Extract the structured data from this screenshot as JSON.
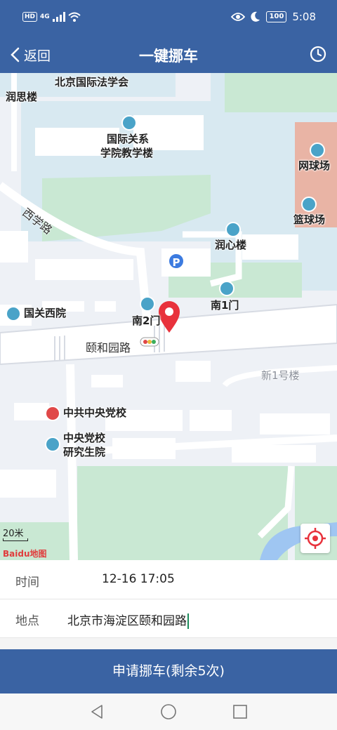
{
  "status_bar": {
    "hd": "HD",
    "network": "4G",
    "battery": "100",
    "time": "5:08"
  },
  "nav": {
    "back_label": "返回",
    "title": "一键挪车"
  },
  "map": {
    "pois": {
      "law_society": "北京国际法学会",
      "runsi": "润思楼",
      "intl_relations_1": "国际关系",
      "intl_relations_2": "学院教学楼",
      "tennis": "网球场",
      "basketball": "篮球场",
      "runxin": "润心楼",
      "south_gate_1": "南1门",
      "south_gate_2": "南2门",
      "guoguan_west": "国关西院",
      "new_building_1": "新1号楼",
      "party_school": "中共中央党校",
      "grad_school_1": "中央党校",
      "grad_school_2": "研究生院"
    },
    "roads": {
      "xixue": "西学路",
      "yihe": "颐和园路"
    },
    "scale_label": "20米",
    "logo": "Baidu地图"
  },
  "form": {
    "time_label": "时间",
    "time_value": "12-16 17:05",
    "place_label": "地点",
    "place_value": "北京市海淀区颐和园路"
  },
  "submit_label": "申请挪车(剩余5次)",
  "colors": {
    "brand": "#3a63a3",
    "pin": "#e8323c"
  }
}
